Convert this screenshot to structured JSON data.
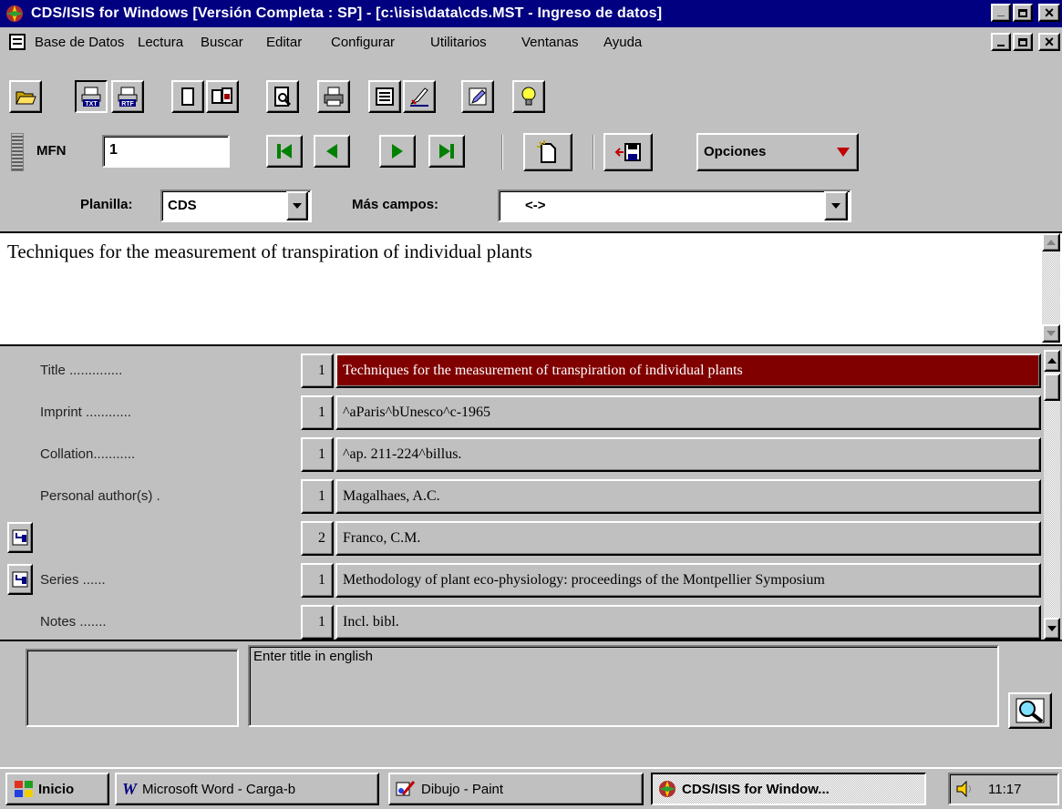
{
  "window": {
    "title": "CDS/ISIS for Windows [Versión Completa : SP] - [c:\\isis\\data\\cds.MST - Ingreso de datos]",
    "minimize": "_",
    "restore": "▫",
    "close": "×"
  },
  "menu": {
    "items": [
      {
        "label": "Base de Datos"
      },
      {
        "label": "Lectura"
      },
      {
        "label": "Buscar"
      },
      {
        "label": "Editar"
      },
      {
        "label": "Configurar"
      },
      {
        "label": "Utilitarios"
      },
      {
        "label": "Ventanas"
      },
      {
        "label": "Ayuda"
      }
    ]
  },
  "toolbar": {
    "icons": [
      "open-folder-icon",
      "print-txt-icon",
      "print-rtf-icon",
      "copy-icon",
      "paste-icon",
      "preview-icon",
      "printer-icon",
      "form-icon",
      "edit-icon",
      "pencil-icon",
      "lightbulb-icon"
    ],
    "txt_label": "TXT",
    "rtf_label": "RTF"
  },
  "record_bar": {
    "mfn_label": "MFN",
    "mfn_value": "1",
    "opciones_label": "Opciones"
  },
  "form_bar": {
    "planilla_label": "Planilla:",
    "planilla_value": "CDS",
    "mas_campos_label": "Más campos:",
    "mas_campos_value": "<->"
  },
  "editor": {
    "text": "Techniques for the measurement of transpiration of individual plants"
  },
  "fields": [
    {
      "label": "Title ..............",
      "occ": "1",
      "value": "Techniques for the measurement of transpiration of individual plants",
      "selected": true,
      "repeat_icon": false
    },
    {
      "label": "Imprint ............",
      "occ": "1",
      "value": "^aParis^bUnesco^c-1965",
      "selected": false,
      "repeat_icon": false
    },
    {
      "label": "Collation...........",
      "occ": "1",
      "value": "^ap. 211-224^billus.",
      "selected": false,
      "repeat_icon": false
    },
    {
      "label": "Personal author(s) .",
      "occ": "1",
      "value": "Magalhaes, A.C.",
      "selected": false,
      "repeat_icon": false
    },
    {
      "label": "",
      "occ": "2",
      "value": "Franco, C.M.",
      "selected": false,
      "repeat_icon": true
    },
    {
      "label": "Series ......",
      "occ": "1",
      "value": "Methodology of plant eco-physiology: proceedings of the Montpellier Symposium",
      "selected": false,
      "repeat_icon": true
    },
    {
      "label": "Notes .......",
      "occ": "1",
      "value": "Incl. bibl.",
      "selected": false,
      "repeat_icon": false
    }
  ],
  "help": {
    "text": "Enter title in english"
  },
  "taskbar": {
    "start_label": "Inicio",
    "tasks": [
      {
        "label": "Microsoft Word - Carga-b",
        "active": false
      },
      {
        "label": "Dibujo - Paint",
        "active": false
      },
      {
        "label": "CDS/ISIS for Window...",
        "active": true
      }
    ],
    "clock": "11:17"
  }
}
